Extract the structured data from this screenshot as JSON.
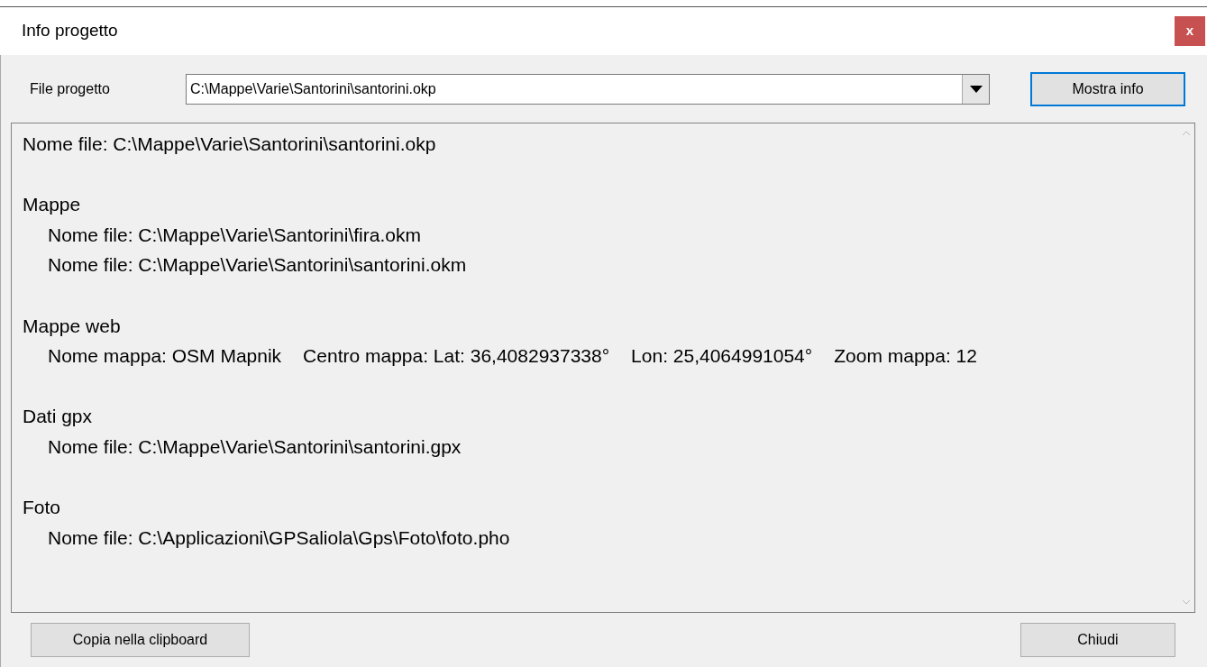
{
  "window": {
    "title": "Info progetto",
    "close": "x"
  },
  "project_file": {
    "label": "File progetto",
    "value": "C:\\Mappe\\Varie\\Santorini\\santorini.okp"
  },
  "show_button": "Mostra info",
  "info": {
    "header": "Nome file: C:\\Mappe\\Varie\\Santorini\\santorini.okp",
    "sections": [
      {
        "title": "Mappe",
        "lines": [
          [
            "Nome file: C:\\Mappe\\Varie\\Santorini\\fira.okm"
          ],
          [
            "Nome file: C:\\Mappe\\Varie\\Santorini\\santorini.okm"
          ]
        ]
      },
      {
        "title": "Mappe web",
        "lines": [
          [
            "Nome mappa: OSM Mapnik",
            "Centro mappa: Lat: 36,4082937338°",
            "Lon: 25,4064991054°",
            "Zoom mappa: 12"
          ]
        ]
      },
      {
        "title": "Dati gpx",
        "lines": [
          [
            "Nome file: C:\\Mappe\\Varie\\Santorini\\santorini.gpx"
          ]
        ]
      },
      {
        "title": "Foto",
        "lines": [
          [
            "Nome file: C:\\Applicazioni\\GPSaliola\\Gps\\Foto\\foto.pho"
          ]
        ]
      }
    ]
  },
  "buttons": [
    "Copia nella clipboard",
    "Chiudi"
  ]
}
